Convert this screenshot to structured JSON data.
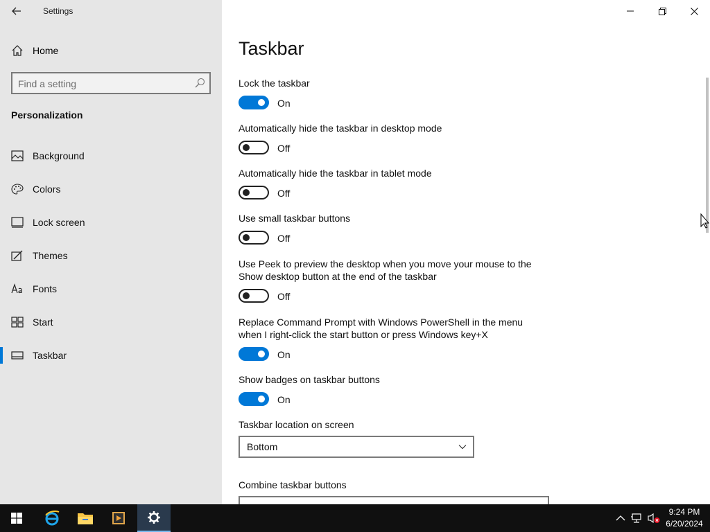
{
  "window": {
    "title": "Settings"
  },
  "nav": {
    "home_label": "Home",
    "search_placeholder": "Find a setting",
    "section_title": "Personalization",
    "items": [
      {
        "label": "Background",
        "icon": "background-icon"
      },
      {
        "label": "Colors",
        "icon": "palette-icon"
      },
      {
        "label": "Lock screen",
        "icon": "lock-screen-icon"
      },
      {
        "label": "Themes",
        "icon": "themes-icon"
      },
      {
        "label": "Fonts",
        "icon": "fonts-icon"
      },
      {
        "label": "Start",
        "icon": "start-icon"
      },
      {
        "label": "Taskbar",
        "icon": "taskbar-icon",
        "active": true
      }
    ]
  },
  "main": {
    "title": "Taskbar",
    "settings": [
      {
        "label": "Lock the taskbar",
        "state": "On"
      },
      {
        "label": "Automatically hide the taskbar in desktop mode",
        "state": "Off"
      },
      {
        "label": "Automatically hide the taskbar in tablet mode",
        "state": "Off"
      },
      {
        "label": "Use small taskbar buttons",
        "state": "Off"
      },
      {
        "label": "Use Peek to preview the desktop when you move your mouse to the Show desktop button at the end of the taskbar",
        "state": "Off"
      },
      {
        "label": "Replace Command Prompt with Windows PowerShell in the menu when I right-click the start button or press Windows key+X",
        "state": "On"
      },
      {
        "label": "Show badges on taskbar buttons",
        "state": "On"
      }
    ],
    "location_label": "Taskbar location on screen",
    "location_value": "Bottom",
    "combine_label": "Combine taskbar buttons"
  },
  "taskbar": {
    "time": "9:24 PM",
    "date": "6/20/2024",
    "apps": [
      "start-icon",
      "internet-explorer-icon",
      "file-explorer-icon",
      "media-player-icon",
      "settings-gear-icon"
    ]
  },
  "colors": {
    "accent": "#0078d7",
    "nav_bg": "#e6e6e6",
    "taskbar_bg": "#101010"
  }
}
